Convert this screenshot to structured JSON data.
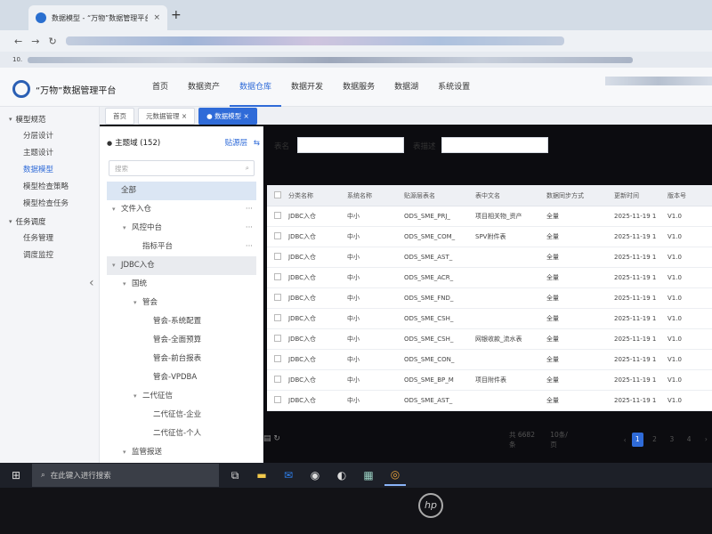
{
  "browser": {
    "tab_title": "数据模型 - “万物”数据管理平台",
    "tab_close": "×",
    "new_tab": "+",
    "url_prefix": "10."
  },
  "app": {
    "title": "“万物”数据管理平台",
    "topnav": [
      "首页",
      "数据资产",
      "数据仓库",
      "数据开发",
      "数据服务",
      "数据湖",
      "系统设置"
    ],
    "topnav_active": "数据仓库"
  },
  "sidebar": {
    "groups": [
      {
        "label": "模型规范",
        "items": [
          "分层设计",
          "主题设计",
          "数据模型",
          "模型检查策略",
          "模型检查任务"
        ]
      },
      {
        "label": "任务调度",
        "items": [
          "任务管理",
          "调度监控"
        ]
      }
    ],
    "active_item": "数据模型"
  },
  "breadcrumbs": [
    "首页",
    "元数据管理",
    "数据模型"
  ],
  "tree": {
    "header": "主题域 (152)",
    "source_link": "贴源层",
    "search_placeholder": "搜索",
    "rows": [
      {
        "label": "全部",
        "indent": 0,
        "caret": "",
        "more": false,
        "state": "sel"
      },
      {
        "label": "文件入仓",
        "indent": 0,
        "caret": "▾",
        "more": true,
        "state": ""
      },
      {
        "label": "风控中台",
        "indent": 1,
        "caret": "▾",
        "more": true,
        "state": ""
      },
      {
        "label": "指标平台",
        "indent": 2,
        "caret": "",
        "more": true,
        "state": ""
      },
      {
        "label": "JDBC入仓",
        "indent": 0,
        "caret": "▾",
        "more": false,
        "state": "hover"
      },
      {
        "label": "国统",
        "indent": 1,
        "caret": "▾",
        "more": false,
        "state": ""
      },
      {
        "label": "管会",
        "indent": 2,
        "caret": "▾",
        "more": false,
        "state": ""
      },
      {
        "label": "管会-系统配置",
        "indent": 3,
        "caret": "",
        "more": false,
        "state": ""
      },
      {
        "label": "管会-全面预算",
        "indent": 3,
        "caret": "",
        "more": false,
        "state": ""
      },
      {
        "label": "管会-前台报表",
        "indent": 3,
        "caret": "",
        "more": false,
        "state": ""
      },
      {
        "label": "管会-VPDBA",
        "indent": 3,
        "caret": "",
        "more": false,
        "state": ""
      },
      {
        "label": "二代征信",
        "indent": 2,
        "caret": "▾",
        "more": false,
        "state": ""
      },
      {
        "label": "二代征信-企业",
        "indent": 3,
        "caret": "",
        "more": false,
        "state": ""
      },
      {
        "label": "二代征信-个人",
        "indent": 3,
        "caret": "",
        "more": false,
        "state": ""
      },
      {
        "label": "监管报送",
        "indent": 1,
        "caret": "▾",
        "more": false,
        "state": ""
      }
    ]
  },
  "filters": {
    "table_name_label": "表名",
    "table_desc_label": "表描述"
  },
  "table": {
    "columns": [
      "分类名称",
      "系统名称",
      "贴源层表名",
      "表中文名",
      "数据同步方式",
      "更新时间",
      "版本号"
    ],
    "rows": [
      [
        "JDBC入仓",
        "中小",
        "ODS_SME_PRJ_",
        "项目相关物_资产",
        "全量",
        "2025-11-19 1",
        "V1.0"
      ],
      [
        "JDBC入仓",
        "中小",
        "ODS_SME_COM_",
        "SPV附件表",
        "全量",
        "2025-11-19 1",
        "V1.0"
      ],
      [
        "JDBC入仓",
        "中小",
        "ODS_SME_AST_",
        "",
        "全量",
        "2025-11-19 1",
        "V1.0"
      ],
      [
        "JDBC入仓",
        "中小",
        "ODS_SME_ACR_",
        "",
        "全量",
        "2025-11-19 1",
        "V1.0"
      ],
      [
        "JDBC入仓",
        "中小",
        "ODS_SME_FND_",
        "",
        "全量",
        "2025-11-19 1",
        "V1.0"
      ],
      [
        "JDBC入仓",
        "中小",
        "ODS_SME_CSH_",
        "",
        "全量",
        "2025-11-19 1",
        "V1.0"
      ],
      [
        "JDBC入仓",
        "中小",
        "ODS_SME_CSH_",
        "网银收款_流水表",
        "全量",
        "2025-11-19 1",
        "V1.0"
      ],
      [
        "JDBC入仓",
        "中小",
        "ODS_SME_CON_",
        "",
        "全量",
        "2025-11-19 1",
        "V1.0"
      ],
      [
        "JDBC入仓",
        "中小",
        "ODS_SME_BP_M",
        "项目附件表",
        "全量",
        "2025-11-19 1",
        "V1.0"
      ],
      [
        "JDBC入仓",
        "中小",
        "ODS_SME_AST_",
        "",
        "全量",
        "2025-11-19 1",
        "V1.0"
      ]
    ]
  },
  "pager": {
    "total": "共 6682 条",
    "page_size": "10条/页",
    "pages": [
      "1",
      "2",
      "3",
      "4"
    ],
    "current": "1"
  },
  "taskbar": {
    "search_placeholder": "在此键入进行搜索"
  },
  "bezel": {
    "brand": "hp"
  }
}
